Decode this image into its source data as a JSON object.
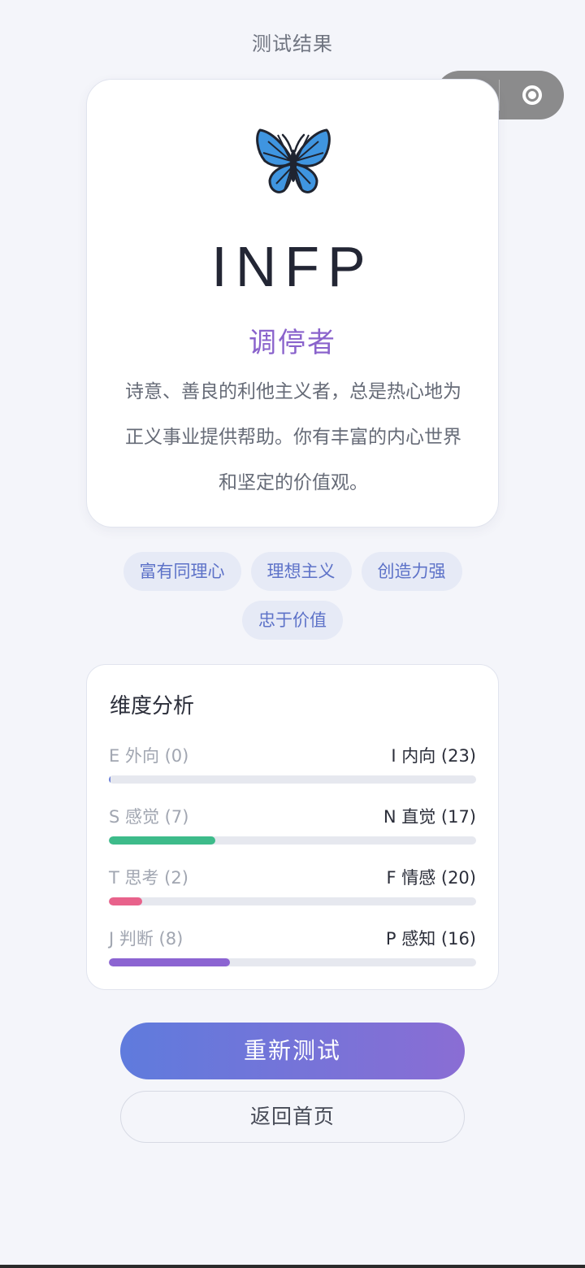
{
  "header": {
    "title": "测试结果"
  },
  "capsule": {
    "more_icon": "more-dots-icon",
    "close_icon": "target-circle-icon"
  },
  "result": {
    "icon": "butterfly-icon",
    "type_code": "INFP",
    "type_name": "调停者",
    "description": "诗意、善良的利他主义者，总是热心地为正义事业提供帮助。你有丰富的内心世界和坚定的价值观。"
  },
  "tags": [
    "富有同理心",
    "理想主义",
    "创造力强",
    "忠于价值"
  ],
  "dimensions": {
    "title": "维度分析",
    "rows": [
      {
        "left": "E 外向 (0)",
        "right": "I 内向 (23)",
        "fill_fraction": 0.0,
        "color": "#6a7fd8"
      },
      {
        "left": "S 感觉 (7)",
        "right": "N 直觉 (17)",
        "fill_fraction": 0.29,
        "color": "#3dbb8a"
      },
      {
        "left": "T 思考 (2)",
        "right": "F 情感 (20)",
        "fill_fraction": 0.09,
        "color": "#e8628b"
      },
      {
        "left": "J 判断 (8)",
        "right": "P 感知 (16)",
        "fill_fraction": 0.33,
        "color": "#8c64d2"
      }
    ]
  },
  "buttons": {
    "retest": "重新测试",
    "home": "返回首页"
  }
}
